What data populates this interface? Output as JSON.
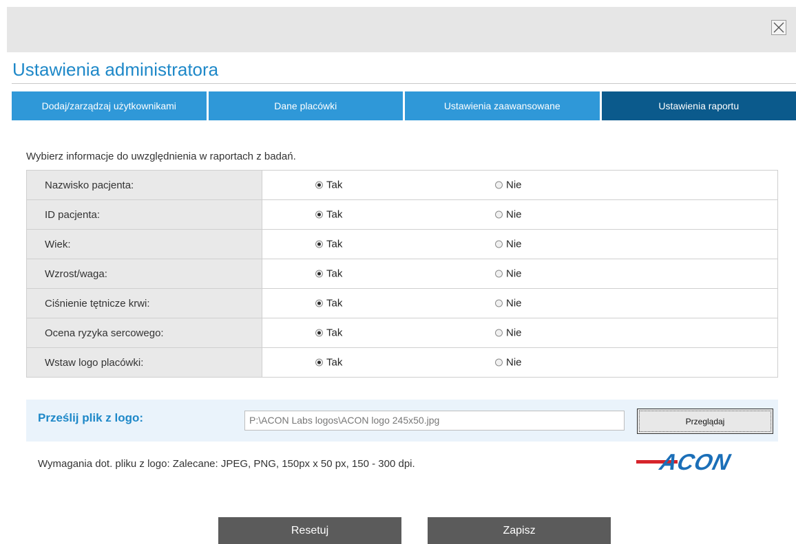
{
  "title": "Ustawienia administratora",
  "tabs": [
    {
      "label": "Dodaj/zarządzaj użytkownikami"
    },
    {
      "label": "Dane placówki"
    },
    {
      "label": "Ustawienia zaawansowane"
    },
    {
      "label": "Ustawienia raportu",
      "active": true
    }
  ],
  "intro": "Wybierz informacje do uwzględnienia w raportach z badań.",
  "options": [
    {
      "label": "Nazwisko pacjenta:",
      "yes": "Tak",
      "no": "Nie",
      "selected": "Tak"
    },
    {
      "label": "ID pacjenta:",
      "yes": "Tak",
      "no": "Nie",
      "selected": "Tak"
    },
    {
      "label": "Wiek:",
      "yes": "Tak",
      "no": "Nie",
      "selected": "Tak"
    },
    {
      "label": "Wzrost/waga:",
      "yes": "Tak",
      "no": "Nie",
      "selected": "Tak"
    },
    {
      "label": "Ciśnienie tętnicze krwi:",
      "yes": "Tak",
      "no": "Nie",
      "selected": "Tak"
    },
    {
      "label": "Ocena ryzyka sercowego:",
      "yes": "Tak",
      "no": "Nie",
      "selected": "Tak"
    },
    {
      "label": "Wstaw logo placówki:",
      "yes": "Tak",
      "no": "Nie",
      "selected": "Tak"
    }
  ],
  "upload": {
    "label": "Prześlij plik z logo:",
    "value": "P:\\ACON Labs logos\\ACON logo 245x50.jpg",
    "browse_label": "Przeglądaj"
  },
  "requirements": "Wymagania dot. pliku z logo: Zalecane: JPEG, PNG, 150px x 50 px, 150 - 300 dpi.",
  "logo": {
    "text": "ACON",
    "colors": {
      "stripe": "#d6242b",
      "text": "#1b6fb8"
    }
  },
  "buttons": {
    "reset": "Resetuj",
    "save": "Zapisz"
  },
  "colors": {
    "accent": "#1e88c8",
    "tab": "#2f98d8",
    "tab_active": "#0b5a8c",
    "button": "#5b5b5b"
  },
  "icons": {
    "close": "close-icon"
  }
}
